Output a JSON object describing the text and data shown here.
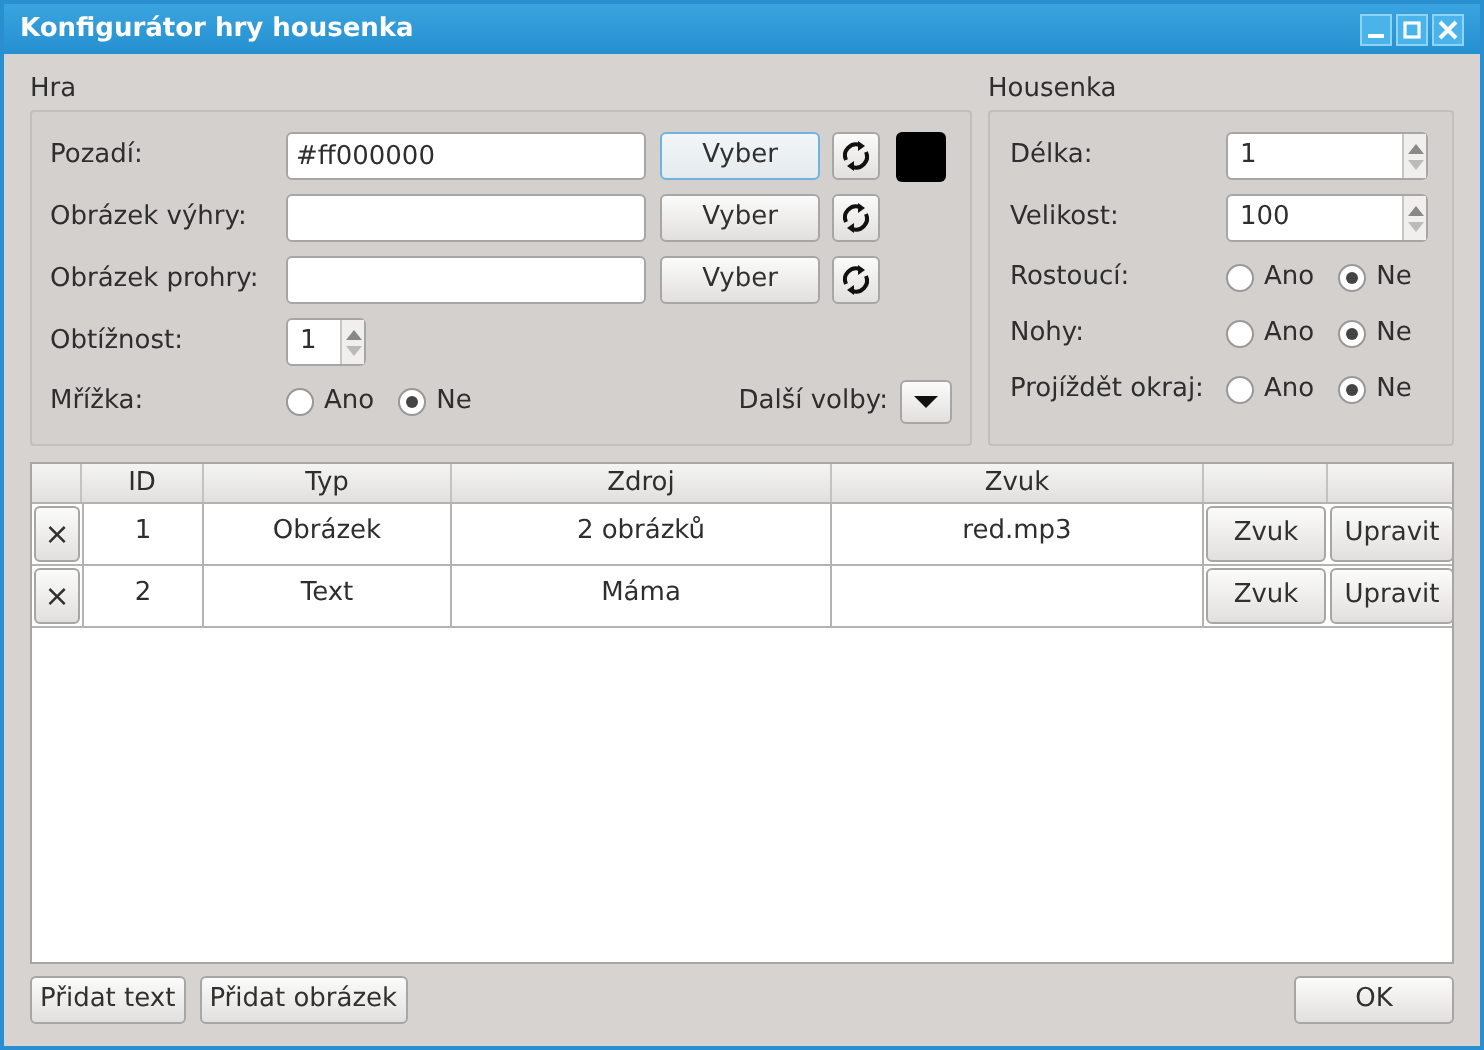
{
  "window": {
    "title": "Konfigurátor hry housenka"
  },
  "game": {
    "title": "Hra",
    "file_rows": [
      {
        "label": "Pozadí:",
        "value": "#ff000000",
        "button": "Vyber",
        "focused": true,
        "color": "#000000"
      },
      {
        "label": "Obrázek výhry:",
        "value": "",
        "button": "Vyber",
        "focused": false
      },
      {
        "label": "Obrázek prohry:",
        "value": "",
        "button": "Vyber",
        "focused": false
      }
    ],
    "difficulty": {
      "label": "Obtížnost:",
      "value": "1"
    },
    "grid": {
      "label": "Mřížka:",
      "options": [
        {
          "label": "Ano",
          "selected": false
        },
        {
          "label": "Ne",
          "selected": true
        }
      ]
    },
    "more": {
      "label": "Další volby:"
    }
  },
  "caterpillar": {
    "title": "Housenka",
    "spinners": [
      {
        "label": "Délka:",
        "value": "1"
      },
      {
        "label": "Velikost:",
        "value": "100"
      }
    ],
    "radios": [
      {
        "label": "Rostoucí:",
        "options": [
          {
            "label": "Ano",
            "selected": false
          },
          {
            "label": "Ne",
            "selected": true
          }
        ]
      },
      {
        "label": "Nohy:",
        "options": [
          {
            "label": "Ano",
            "selected": false
          },
          {
            "label": "Ne",
            "selected": true
          }
        ]
      },
      {
        "label": "Projíždět okraj:",
        "options": [
          {
            "label": "Ano",
            "selected": false
          },
          {
            "label": "Ne",
            "selected": true
          }
        ]
      }
    ]
  },
  "table": {
    "columns": [
      "ID",
      "Typ",
      "Zdroj",
      "Zvuk"
    ],
    "rows": [
      {
        "delete": "×",
        "id": "1",
        "type": "Obrázek",
        "source": "2 obrázků",
        "sound": "red.mp3",
        "sound_button": "Zvuk",
        "edit_button": "Upravit"
      },
      {
        "delete": "×",
        "id": "2",
        "type": "Text",
        "source": "Máma",
        "sound": "",
        "sound_button": "Zvuk",
        "edit_button": "Upravit"
      }
    ]
  },
  "footer": {
    "buttons": [
      "Přidat text",
      "Přidat obrázek"
    ],
    "ok": "OK"
  }
}
